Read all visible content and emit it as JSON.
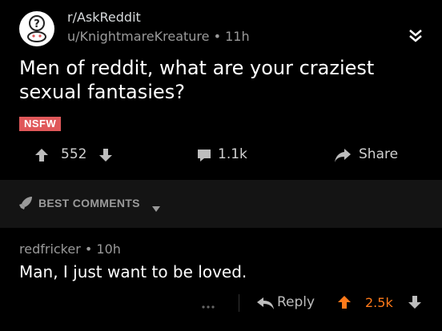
{
  "post": {
    "subreddit": "r/AskReddit",
    "author": "u/KnightmareKreature",
    "separator": "•",
    "age": "11h",
    "title": "Men of reddit, what are your craziest sexual fantasies?",
    "nsfw_label": "NSFW",
    "score": "552",
    "comment_count": "1.1k",
    "share_label": "Share"
  },
  "sort": {
    "label": "BEST COMMENTS"
  },
  "comment": {
    "author": "redfricker",
    "separator": "•",
    "age": "10h",
    "body": "Man, I just want to be loved.",
    "more": "...",
    "reply_label": "Reply",
    "score": "2.5k"
  },
  "colors": {
    "background": "#000000",
    "sort_bar": "#141414",
    "nsfw": "#e0585a",
    "upvote_active": "#ff7a1a",
    "muted_text": "#9a9a9a"
  },
  "icons": {
    "avatar": "askreddit-avatar-icon",
    "collapse": "double-chevron-down-icon",
    "upvote": "arrow-up-icon",
    "downvote": "arrow-down-icon",
    "comments": "speech-bubble-icon",
    "share": "share-arrow-icon",
    "sort": "rocket-icon",
    "caret": "caret-down-icon",
    "more": "ellipsis-icon",
    "reply": "reply-arrow-icon"
  }
}
